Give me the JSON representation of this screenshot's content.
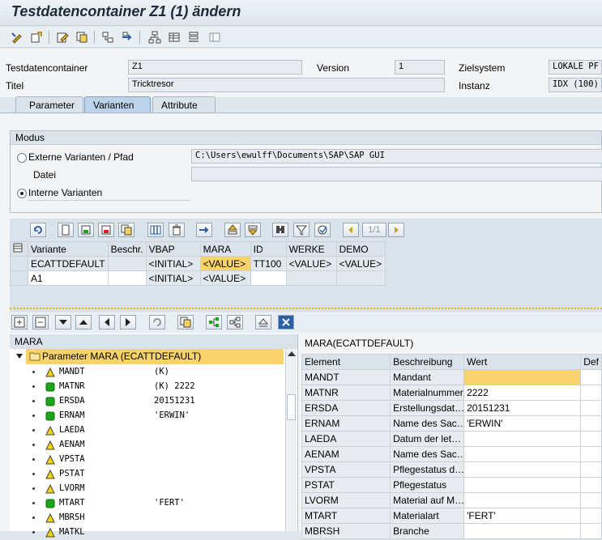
{
  "window": {
    "title": "Testdatencontainer Z1 (1) ändern"
  },
  "header": {
    "container_label": "Testdatencontainer",
    "container_value": "Z1",
    "version_label": "Version",
    "version_value": "1",
    "zielsystem_label": "Zielsystem",
    "zielsystem_value": "LOKALE PF",
    "titel_label": "Titel",
    "titel_value": "Tricktresor",
    "instanz_label": "Instanz",
    "instanz_value": "IDX (100)"
  },
  "tabs": [
    {
      "label": "Parameter"
    },
    {
      "label": "Varianten"
    },
    {
      "label": "Attribute"
    }
  ],
  "modus": {
    "title": "Modus",
    "ext_label": "Externe Varianten / Pfad",
    "ext_path": "C:\\Users\\ewulff\\Documents\\SAP\\SAP GUI",
    "datei_label": "Datei",
    "datei_value": "",
    "int_label": "Interne Varianten"
  },
  "grid_toolbar": {
    "page": "1/1"
  },
  "variants": {
    "columns": [
      "Variante",
      "Beschr.",
      "VBAP",
      "MARA",
      "ID",
      "WERKE",
      "DEMO"
    ],
    "rows": [
      [
        "ECATTDEFAULT",
        "",
        "<INITIAL>",
        "<VALUE>",
        "TT100",
        "<VALUE>",
        "<VALUE>"
      ],
      [
        "A1",
        "",
        "<INITIAL>",
        "<VALUE>",
        "",
        "",
        ""
      ]
    ]
  },
  "tree": {
    "header": "MARA",
    "root": "Parameter MARA (ECATTDEFAULT)",
    "items": [
      {
        "name": "MANDT",
        "value": "(K)",
        "status": "yellow"
      },
      {
        "name": "MATNR",
        "value": "(K) 2222",
        "status": "green"
      },
      {
        "name": "ERSDA",
        "value": "20151231",
        "status": "green"
      },
      {
        "name": "ERNAM",
        "value": "'ERWIN'",
        "status": "green"
      },
      {
        "name": "LAEDA",
        "value": "",
        "status": "yellow"
      },
      {
        "name": "AENAM",
        "value": "",
        "status": "yellow"
      },
      {
        "name": "VPSTA",
        "value": "",
        "status": "yellow"
      },
      {
        "name": "PSTAT",
        "value": "",
        "status": "yellow"
      },
      {
        "name": "LVORM",
        "value": "",
        "status": "yellow"
      },
      {
        "name": "MTART",
        "value": "'FERT'",
        "status": "green"
      },
      {
        "name": "MBRSH",
        "value": "",
        "status": "yellow"
      },
      {
        "name": "MATKL",
        "value": "",
        "status": "yellow"
      }
    ]
  },
  "details": {
    "header": "MARA(ECATTDEFAULT)",
    "columns": [
      "Element",
      "Beschreibung",
      "Wert",
      "Def"
    ],
    "rows": [
      [
        "MANDT",
        "Mandant",
        ""
      ],
      [
        "MATNR",
        "Materialnummer",
        "2222"
      ],
      [
        "ERSDA",
        "Erstellungsdat…",
        "20151231"
      ],
      [
        "ERNAM",
        "Name des Sac…",
        "'ERWIN'"
      ],
      [
        "LAEDA",
        "Datum der let…",
        ""
      ],
      [
        "AENAM",
        "Name des Sac…",
        ""
      ],
      [
        "VPSTA",
        "Pflegestatus d…",
        ""
      ],
      [
        "PSTAT",
        "Pflegestatus",
        ""
      ],
      [
        "LVORM",
        "Material auf M…",
        ""
      ],
      [
        "MTART",
        "Materialart",
        "'FERT'"
      ],
      [
        "MBRSH",
        "Branche",
        ""
      ]
    ]
  },
  "colors": {
    "highlight": "#f8d36b",
    "status_green": "#1aa51a",
    "status_yellow": "#f2d600"
  }
}
